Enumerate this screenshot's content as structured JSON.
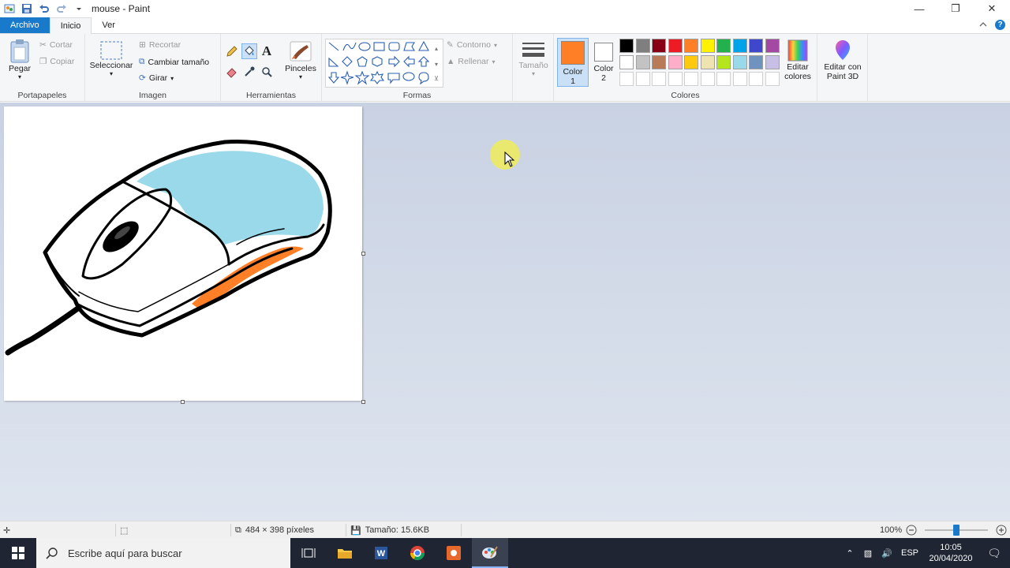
{
  "window": {
    "title": "mouse - Paint"
  },
  "tabs": {
    "file": "Archivo",
    "home": "Inicio",
    "view": "Ver"
  },
  "clipboard": {
    "paste": "Pegar",
    "cut": "Cortar",
    "copy": "Copiar",
    "label": "Portapapeles"
  },
  "image": {
    "select": "Seleccionar",
    "crop": "Recortar",
    "resize": "Cambiar tamaño",
    "rotate": "Girar",
    "label": "Imagen"
  },
  "tools": {
    "label": "Herramientas",
    "brushes": "Pinceles"
  },
  "shapes": {
    "outline": "Contorno",
    "fill": "Rellenar",
    "label": "Formas"
  },
  "size": {
    "label": "Tamaño"
  },
  "colors": {
    "color1_label": "Color 1",
    "color2_label": "Color 2",
    "label": "Colores",
    "edit_colors": "Editar colores",
    "edit_3d": "Editar con Paint 3D",
    "color1": "#ff7f27",
    "color2": "#ffffff",
    "palette_row1": [
      "#000000",
      "#7f7f7f",
      "#880015",
      "#ed1c24",
      "#ff7f27",
      "#fff200",
      "#22b14c",
      "#00a2e8",
      "#3f48cc",
      "#a349a4"
    ],
    "palette_row2": [
      "#ffffff",
      "#c3c3c3",
      "#b97a57",
      "#ffaec9",
      "#ffc90e",
      "#efe4b0",
      "#b5e61d",
      "#99d9ea",
      "#7092be",
      "#c8bfe7"
    ]
  },
  "status": {
    "dimensions": "484 × 398 píxeles",
    "filesize": "Tamaño: 15.6KB",
    "zoom": "100%"
  },
  "taskbar": {
    "search_placeholder": "Escribe aquí para buscar",
    "lang": "ESP",
    "time": "10:05",
    "date": "20/04/2020"
  }
}
